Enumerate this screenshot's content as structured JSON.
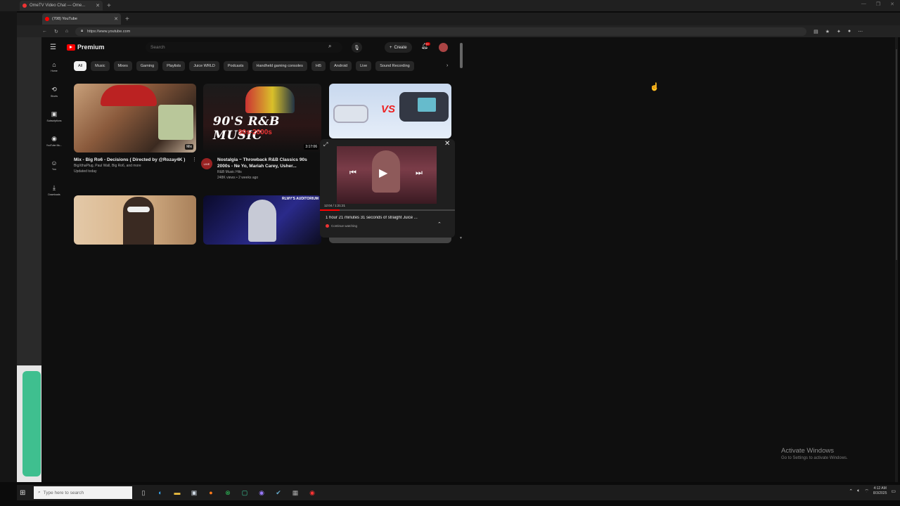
{
  "outer_browser": {
    "tab_title": "OmeTV Video Chat — Ome..."
  },
  "inner_browser": {
    "tab_title": "(708) YouTube",
    "url": "https://www.youtube.com"
  },
  "youtube": {
    "logo_label": "Premium",
    "search_placeholder": "Search",
    "create_label": "Create",
    "notification_count": "9+",
    "chips": [
      "All",
      "Music",
      "Mixes",
      "Gaming",
      "Playlists",
      "Juice WRLD",
      "Podcasts",
      "Handheld gaming consoles",
      "Hi5",
      "Android",
      "Live",
      "Sound Recording"
    ],
    "guide": [
      {
        "label": "Home",
        "icon": "home-icon"
      },
      {
        "label": "Shorts",
        "icon": "shorts-icon"
      },
      {
        "label": "Subscriptions",
        "icon": "subscriptions-icon"
      },
      {
        "label": "YouTube Mu...",
        "icon": "youtube-music-icon"
      },
      {
        "label": "You",
        "icon": "you-icon"
      },
      {
        "label": "Downloads",
        "icon": "download-icon"
      }
    ],
    "videos": [
      {
        "title": "Mix - Big Ro6 - Decisions ( Directed by @Rozay4K )",
        "meta1": "BigXthaPlug, Paul Wall, Big Ro6, and more",
        "meta2": "Updated today",
        "badge": "Mix"
      },
      {
        "title": "Nostalgia ~ Throwback R&B Classics 90s 2000s - Ne Yo, Mariah Carey, Usher...",
        "meta1": "R&B Music Hits",
        "meta2": "248K views • 2 weeks ago",
        "duration": "3:17:06",
        "thumb_title": "90'S R&B MUSIC",
        "thumb_sub": "90s-2000s",
        "channel_badge": "LIVE"
      },
      {
        "thumb_label": "VS"
      },
      {
        "thumb_label": "RLWY'S AUDITORIUM"
      }
    ],
    "miniplayer": {
      "time": "12:04 / 1:21:21",
      "title": "1 hour 21 minutes 31 seconds of straight Juice ...",
      "status": "Continue watching",
      "progress": 0.148
    }
  },
  "activate_windows": {
    "title": "Activate Windows",
    "subtitle": "Go to Settings to activate Windows."
  },
  "taskbar": {
    "search_placeholder": "Type here to search",
    "time": "4:12 AM",
    "date": "8/3/2025"
  },
  "colors": {
    "youtube_red": "#ff0000",
    "background": "#0f0f0f"
  }
}
